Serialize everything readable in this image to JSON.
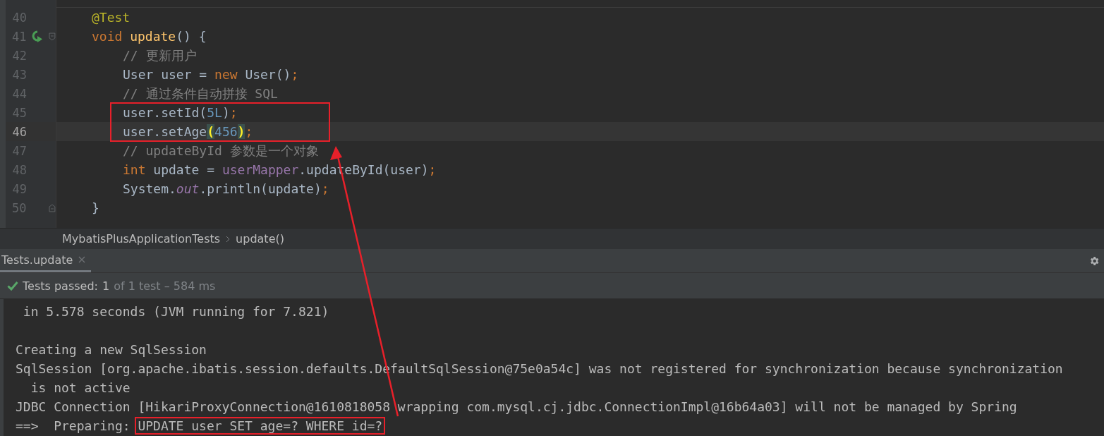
{
  "editor": {
    "lines": [
      {
        "number": "40",
        "current": false,
        "tokens": [
          {
            "kind": "annotation",
            "text": "@Test"
          }
        ]
      },
      {
        "number": "41",
        "current": false,
        "run_marker": true,
        "fold_start": true,
        "tokens": [
          {
            "kind": "keyword",
            "text": "void "
          },
          {
            "kind": "declaration",
            "text": "update"
          },
          {
            "kind": "plain",
            "text": "() {"
          }
        ],
        "children": [
          {
            "number": "42",
            "current": false,
            "tokens": [
              {
                "kind": "comment",
                "text": "// 更新用户"
              }
            ]
          },
          {
            "number": "43",
            "current": false,
            "tokens": [
              {
                "kind": "plain",
                "text": "User user = "
              },
              {
                "kind": "keyword",
                "text": "new "
              },
              {
                "kind": "plain",
                "text": "User()"
              },
              {
                "kind": "keyword",
                "text": ";"
              }
            ]
          },
          {
            "number": "44",
            "current": false,
            "tokens": [
              {
                "kind": "comment",
                "text": "// 通过条件自动拼接 SQL"
              }
            ]
          },
          {
            "number": "45",
            "current": false,
            "boxed": true,
            "tokens": [
              {
                "kind": "plain",
                "text": "user.setId("
              },
              {
                "kind": "number",
                "text": "5L"
              },
              {
                "kind": "plain",
                "text": ")"
              },
              {
                "kind": "keyword",
                "text": ";"
              }
            ]
          },
          {
            "number": "46",
            "current": true,
            "boxed": true,
            "tokens": [
              {
                "kind": "plain",
                "text": "user.setAge"
              },
              {
                "kind": "brace",
                "text": "("
              },
              {
                "kind": "number",
                "text": "456"
              },
              {
                "kind": "brace",
                "text": ")"
              },
              {
                "kind": "keyword",
                "text": ";"
              }
            ]
          },
          {
            "number": "47",
            "current": false,
            "tokens": [
              {
                "kind": "comment",
                "text": "// updateById 参数是一个对象"
              }
            ]
          },
          {
            "number": "48",
            "current": false,
            "tokens": [
              {
                "kind": "keyword",
                "text": "int "
              },
              {
                "kind": "plain",
                "text": "update = "
              },
              {
                "kind": "field",
                "text": "userMapper"
              },
              {
                "kind": "plain",
                "text": ".updateById(user)"
              },
              {
                "kind": "keyword",
                "text": ";"
              }
            ]
          },
          {
            "number": "49",
            "current": false,
            "tokens": [
              {
                "kind": "plain",
                "text": "System."
              },
              {
                "kind": "static",
                "text": "out"
              },
              {
                "kind": "plain",
                "text": ".println(update)"
              },
              {
                "kind": "keyword",
                "text": ";"
              }
            ]
          }
        ]
      },
      {
        "number": "50",
        "current": false,
        "fold_end": true,
        "tokens": [
          {
            "kind": "plain",
            "text": "}"
          }
        ]
      }
    ]
  },
  "breadcrumb": [
    "MybatisPlusApplicationTests",
    "update()"
  ],
  "run_tabs": [
    {
      "label": "Tests.update",
      "selected": true
    }
  ],
  "status": {
    "label": "Tests passed:",
    "count": "1",
    "detail": "of 1 test – 584 ms"
  },
  "console": [
    {
      "kind": "continuation",
      "segments": [
        {
          "text": "in 5.578 seconds (JVM running for 7.821)",
          "boxed": false
        }
      ]
    },
    {
      "kind": "blank"
    },
    {
      "kind": "line",
      "segments": [
        {
          "text": "Creating a new SqlSession",
          "boxed": false
        }
      ]
    },
    {
      "kind": "line",
      "segments": [
        {
          "text": "SqlSession [org.apache.ibatis.session.defaults.DefaultSqlSession@75e0a54c] was not registered for synchronization because synchronization",
          "boxed": false
        }
      ]
    },
    {
      "kind": "wrapped",
      "segments": [
        {
          "text": "is not active",
          "boxed": false
        }
      ]
    },
    {
      "kind": "line",
      "segments": [
        {
          "text": "JDBC Connection [HikariProxyConnection@1610818058 wrapping com.mysql.cj.jdbc.ConnectionImpl@16b64a03] will not be managed by Spring",
          "boxed": false
        }
      ]
    },
    {
      "kind": "line",
      "segments": [
        {
          "text": "==>  Preparing: ",
          "boxed": false
        },
        {
          "text": "UPDATE user SET age=? WHERE id=?",
          "boxed": true
        }
      ]
    }
  ]
}
